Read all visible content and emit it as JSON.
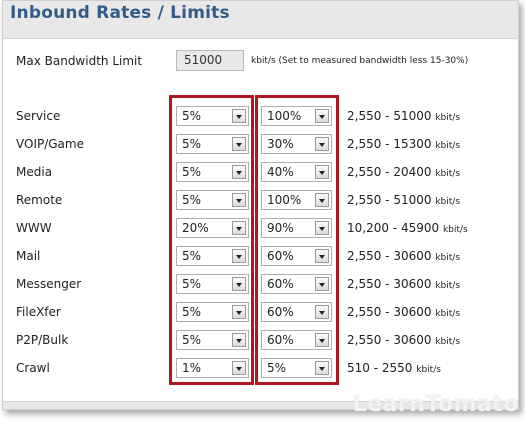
{
  "title": "Inbound Rates / Limits",
  "bandwidth": {
    "label": "Max Bandwidth Limit",
    "value": "51000",
    "note": "kbit/s (Set to measured bandwidth less 15-30%)"
  },
  "unit": "kbit/s",
  "rows": [
    {
      "name": "Service",
      "min": "5%",
      "max": "100%",
      "range": "2,550 - 51000"
    },
    {
      "name": "VOIP/Game",
      "min": "5%",
      "max": "30%",
      "range": "2,550 - 15300"
    },
    {
      "name": "Media",
      "min": "5%",
      "max": "40%",
      "range": "2,550 - 20400"
    },
    {
      "name": "Remote",
      "min": "5%",
      "max": "100%",
      "range": "2,550 - 51000"
    },
    {
      "name": "WWW",
      "min": "20%",
      "max": "90%",
      "range": "10,200 - 45900"
    },
    {
      "name": "Mail",
      "min": "5%",
      "max": "60%",
      "range": "2,550 - 30600"
    },
    {
      "name": "Messenger",
      "min": "5%",
      "max": "60%",
      "range": "2,550 - 30600"
    },
    {
      "name": "FileXfer",
      "min": "5%",
      "max": "60%",
      "range": "2,550 - 30600"
    },
    {
      "name": "P2P/Bulk",
      "min": "5%",
      "max": "60%",
      "range": "2,550 - 30600"
    },
    {
      "name": "Crawl",
      "min": "1%",
      "max": "5%",
      "range": "510 - 2550"
    }
  ],
  "watermark": "LearnTomato",
  "colors": {
    "title": "#345c86",
    "highlight": "#b01820"
  }
}
